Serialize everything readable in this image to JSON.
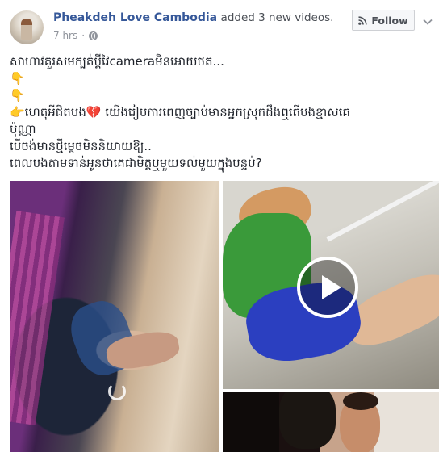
{
  "post": {
    "author": "Pheakdeh Love Cambodia",
    "action": "added 3 new videos.",
    "time": "7 hrs",
    "follow_label": "Follow",
    "text_lines": [
      "សាហាវគួរសមក្បត់ប្តីវៃcameraមិនអោយថត...",
      "👇",
      "👇",
      "👉ហេតុអីជិតបង💔 យើងរៀបការពេញច្បាប់មានអ្នកស្រុកដឹងឮតើបងខ្មាសគេ",
      "ប៉ុណ្ណា",
      "បើចង់មានថ្មីម្តេចមិននិយាយឱ្យ..",
      "ពេលបងតាមទាន់អូនថាគេជាមិត្តឬមួយទល់មួយក្នុងបន្ទប់?"
    ]
  },
  "icons": {
    "privacy": "globe-icon",
    "follow": "rss-icon",
    "menu": "chevron-down-icon",
    "play": "play-icon",
    "loading": "loading-spinner-icon"
  },
  "colors": {
    "author_link": "#365899",
    "meta_text": "#90949c",
    "button_bg": "#f6f7f9",
    "button_border": "#ced0d4"
  }
}
